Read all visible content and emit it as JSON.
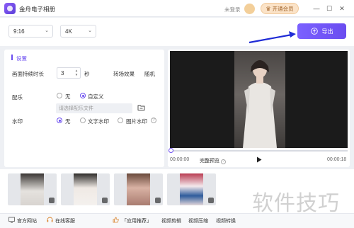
{
  "window": {
    "title": "金舟电子相册",
    "login_status": "未登录",
    "vip_label": "开通会员",
    "controls": [
      "minimize-icon",
      "maximize-icon",
      "close-icon"
    ]
  },
  "toolbar": {
    "aspect_ratio": "9:16",
    "resolution": "4K",
    "export_label": "导出"
  },
  "settings": {
    "title": "设置",
    "duration_label": "画面持续时长",
    "duration_value": "3",
    "duration_unit": "秒",
    "transition_label": "转场效果",
    "transition_value": "随机",
    "music_label": "配乐",
    "music_options": [
      {
        "label": "无",
        "selected": false
      },
      {
        "label": "自定义",
        "selected": true
      }
    ],
    "music_file_placeholder": "请选择配乐文件",
    "watermark_label": "水印",
    "watermark_options": [
      {
        "label": "无",
        "selected": true
      },
      {
        "label": "文字水印",
        "selected": false
      },
      {
        "label": "图片水印",
        "selected": false
      }
    ]
  },
  "preview": {
    "current_time": "00:00:00",
    "full_preview_label": "完整预览",
    "total_time": "00:00:18",
    "progress_fraction": 0
  },
  "thumbnails": [
    "photo-1",
    "photo-2",
    "photo-3",
    "photo-4"
  ],
  "footer": {
    "official_site": "官方网站",
    "online_service": "在线客服",
    "app_recommend": "「应用推荐」",
    "links": [
      "视频剪辑",
      "视频压缩",
      "视频转换"
    ]
  },
  "watermark_text": "软件技巧",
  "colors": {
    "accent": "#6a4cf0",
    "vip_bg": "#fbe3c8",
    "annotation_arrow": "#1f2bd6"
  }
}
